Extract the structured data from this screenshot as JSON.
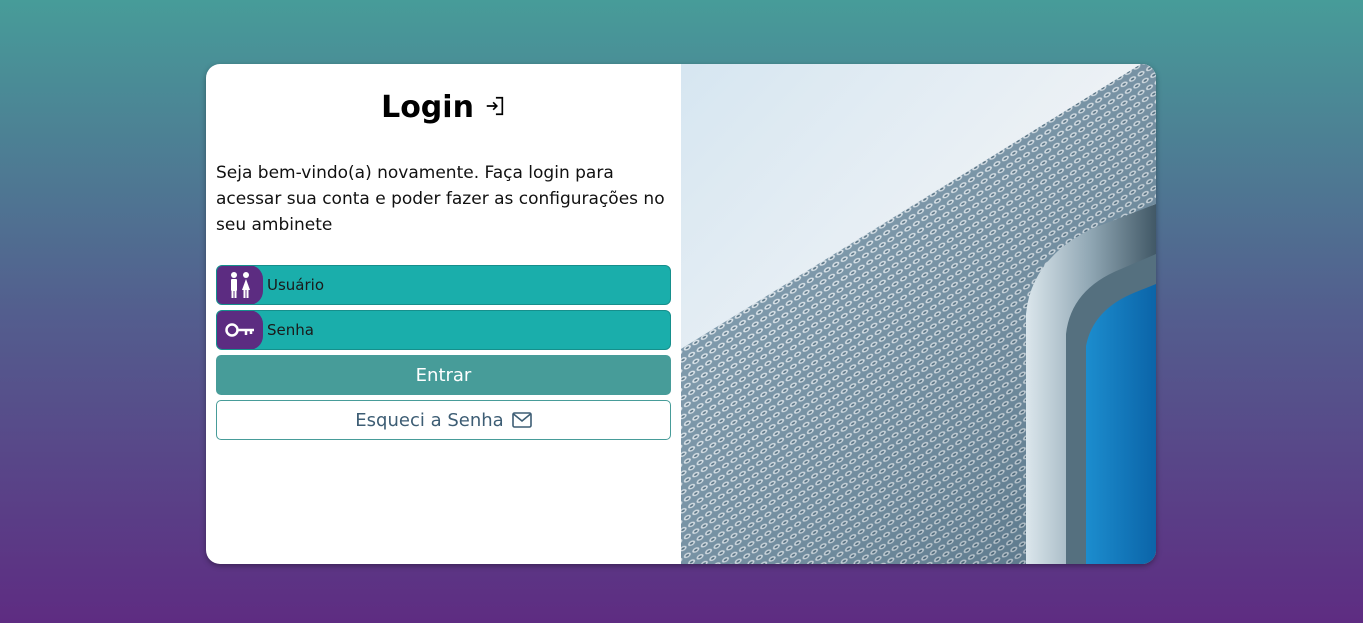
{
  "login": {
    "title": "Login",
    "welcome": "Seja bem-vindo(a) novamente. Faça login para acessar sua conta e poder fazer as configurações no seu ambinete",
    "username_placeholder": "Usuário",
    "password_placeholder": "Senha",
    "submit_label": "Entrar",
    "forgot_label": "Esqueci a Senha"
  },
  "icons": {
    "title": "login-icon",
    "username": "users-icon",
    "password": "key-icon",
    "forgot": "envelope-icon",
    "image": "building-facade-photo"
  },
  "colors": {
    "accent": "#479c99",
    "field_bg": "#1aaeab",
    "icon_bg": "#5c2c81",
    "gradient_top": "#479c99",
    "gradient_bottom": "#5e2c82"
  }
}
